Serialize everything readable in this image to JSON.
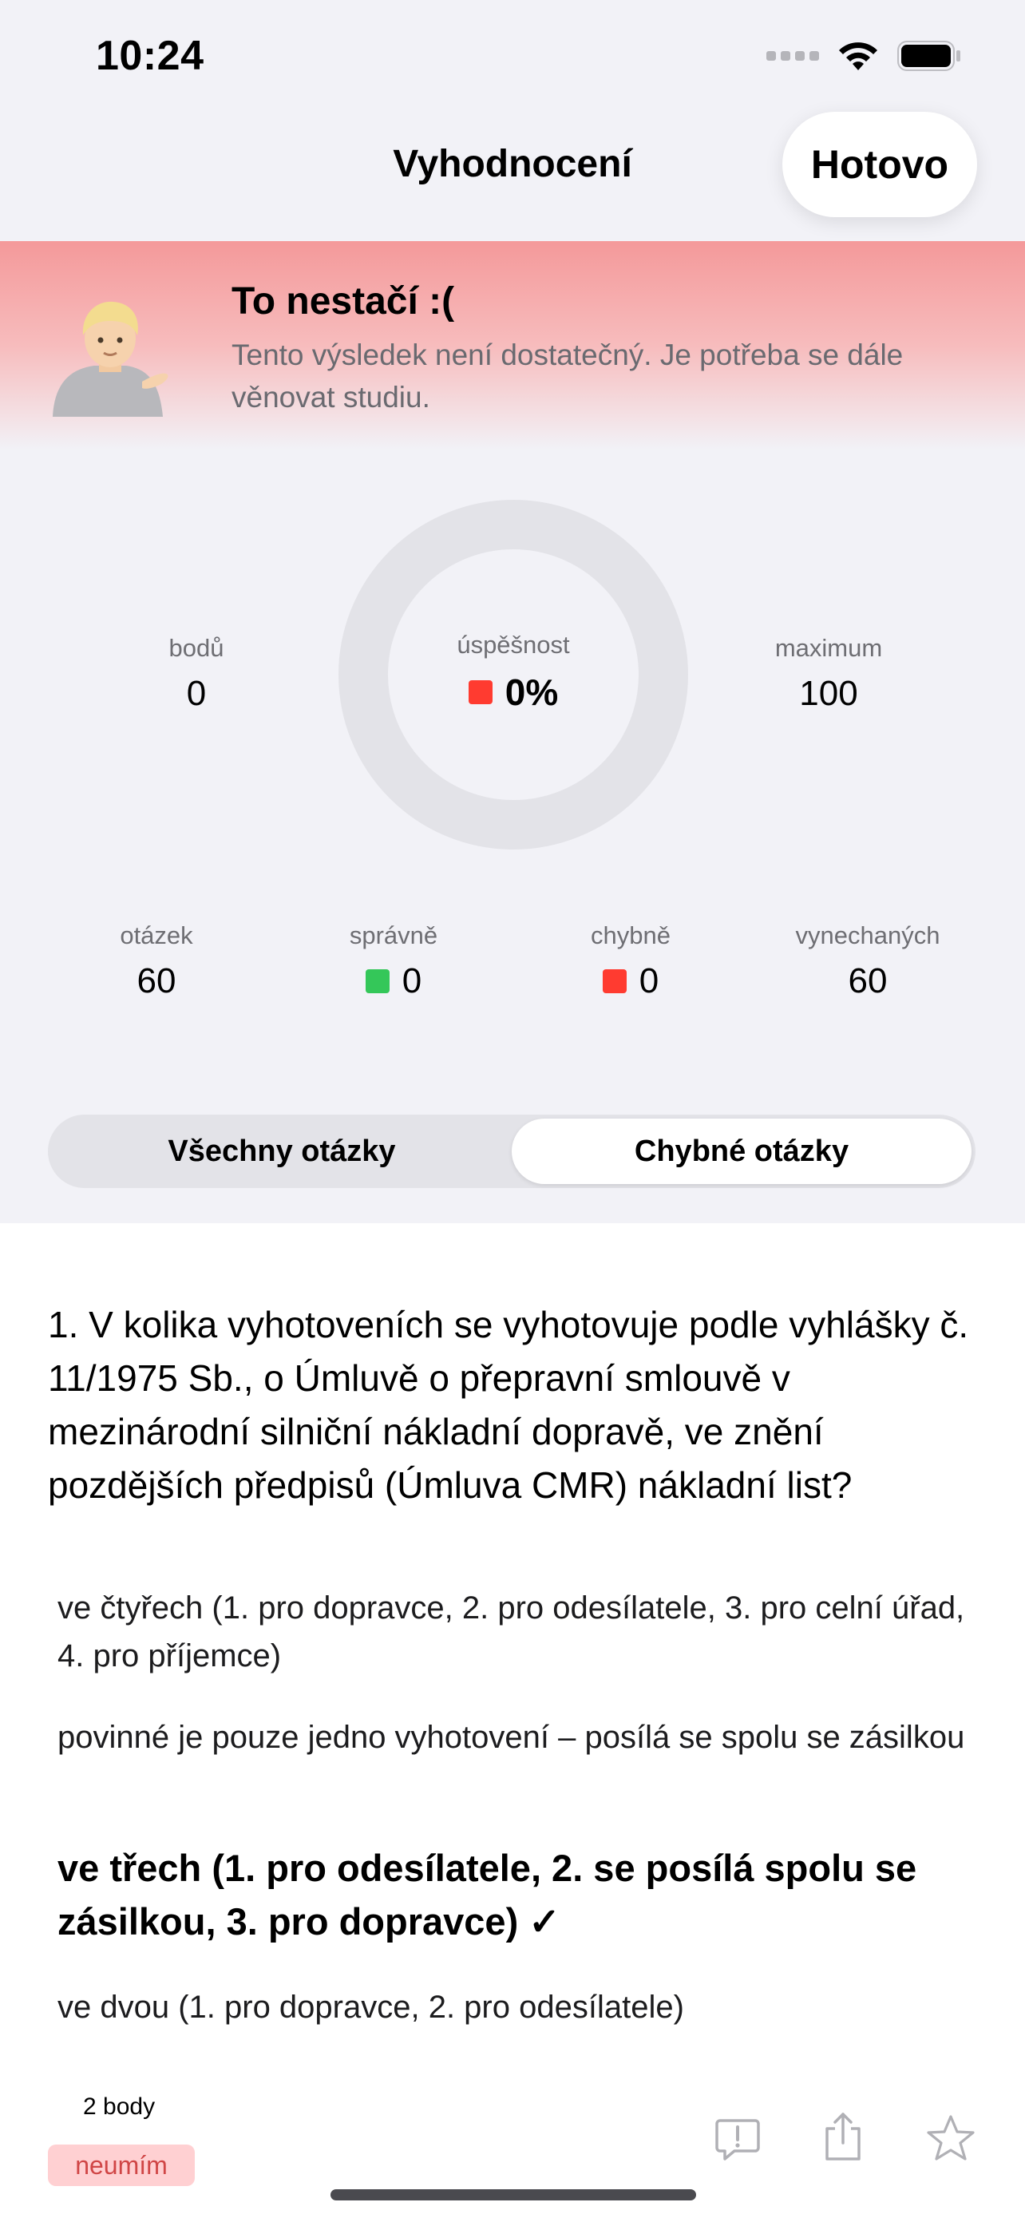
{
  "status_bar": {
    "time": "10:24"
  },
  "nav": {
    "title": "Vyhodnocení",
    "done_label": "Hotovo"
  },
  "banner": {
    "title": "To nestačí :(",
    "text": "Tento výsledek není dostatečný. Je potřeba se dále věnovat studiu."
  },
  "stats": {
    "points_label": "bodů",
    "points_value": "0",
    "success_label": "úspěšnost",
    "success_value": "0%",
    "max_label": "maximum",
    "max_value": "100",
    "success_fraction": 0
  },
  "counts": {
    "questions_label": "otázek",
    "questions_value": "60",
    "correct_label": "správně",
    "correct_value": "0",
    "wrong_label": "chybně",
    "wrong_value": "0",
    "skipped_label": "vynechaných",
    "skipped_value": "60"
  },
  "segmented": {
    "all_label": "Všechny otázky",
    "wrong_label": "Chybné otázky",
    "selected": "Chybné otázky"
  },
  "question": {
    "text": "1. V kolika vyhotoveních se vyhotovuje podle vyhlášky č. 11/1975 Sb., o Úmluvě o přepravní smlouvě v mezinárodní silniční nákladní dopravě, ve znění pozdějších předpisů (Úmluva CMR) nákladní list?",
    "answers": [
      "ve čtyřech (1. pro dopravce, 2. pro odesílatele, 3. pro celní úřad, 4. pro příjemce)",
      "povinné je pouze jedno vyhotovení – posílá se spolu se zásilkou",
      "ve třech (1. pro odesílatele, 2. se posílá spolu se zásilkou, 3. pro dopravce) ✓",
      "ve dvou (1. pro dopravce, 2. pro odesílatele)"
    ],
    "points": "2 body",
    "tag": "neumím"
  },
  "colors": {
    "red": "#ff3b30",
    "green": "#34c759",
    "tag_bg": "#ffd0d2"
  },
  "icons": [
    "feedback-icon",
    "share-icon",
    "star-icon"
  ]
}
